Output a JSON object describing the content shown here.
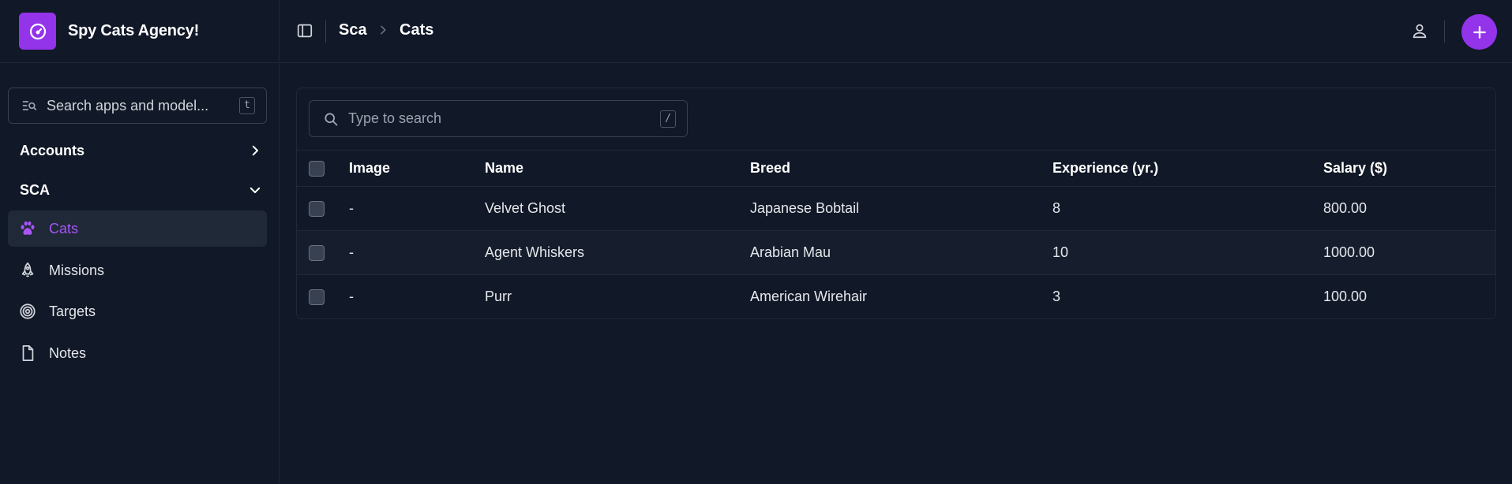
{
  "brand": {
    "name": "Spy Cats Agency!"
  },
  "sidebar": {
    "search_placeholder": "Search apps and model...",
    "search_shortcut": "t",
    "groups": [
      {
        "label": "Accounts",
        "icon": "chevron-right-icon"
      },
      {
        "label": "SCA",
        "icon": "chevron-down-icon"
      }
    ],
    "items": [
      {
        "label": "Cats",
        "icon": "paw-icon",
        "active": true
      },
      {
        "label": "Missions",
        "icon": "rocket-icon",
        "active": false
      },
      {
        "label": "Targets",
        "icon": "target-icon",
        "active": false
      },
      {
        "label": "Notes",
        "icon": "file-icon",
        "active": false
      }
    ]
  },
  "header": {
    "breadcrumb": [
      "Sca",
      "Cats"
    ]
  },
  "table": {
    "search_placeholder": "Type to search",
    "search_shortcut": "/",
    "columns": [
      "Image",
      "Name",
      "Breed",
      "Experience (yr.)",
      "Salary ($)"
    ],
    "rows": [
      {
        "image": "-",
        "name": "Velvet Ghost",
        "breed": "Japanese Bobtail",
        "experience": "8",
        "salary": "800.00"
      },
      {
        "image": "-",
        "name": "Agent Whiskers",
        "breed": "Arabian Mau",
        "experience": "10",
        "salary": "1000.00"
      },
      {
        "image": "-",
        "name": "Purr",
        "breed": "American Wirehair",
        "experience": "3",
        "salary": "100.00"
      }
    ]
  },
  "colors": {
    "accent": "#9333ea",
    "accent_text": "#a855f7",
    "background": "#111827",
    "border": "#1f2937"
  }
}
